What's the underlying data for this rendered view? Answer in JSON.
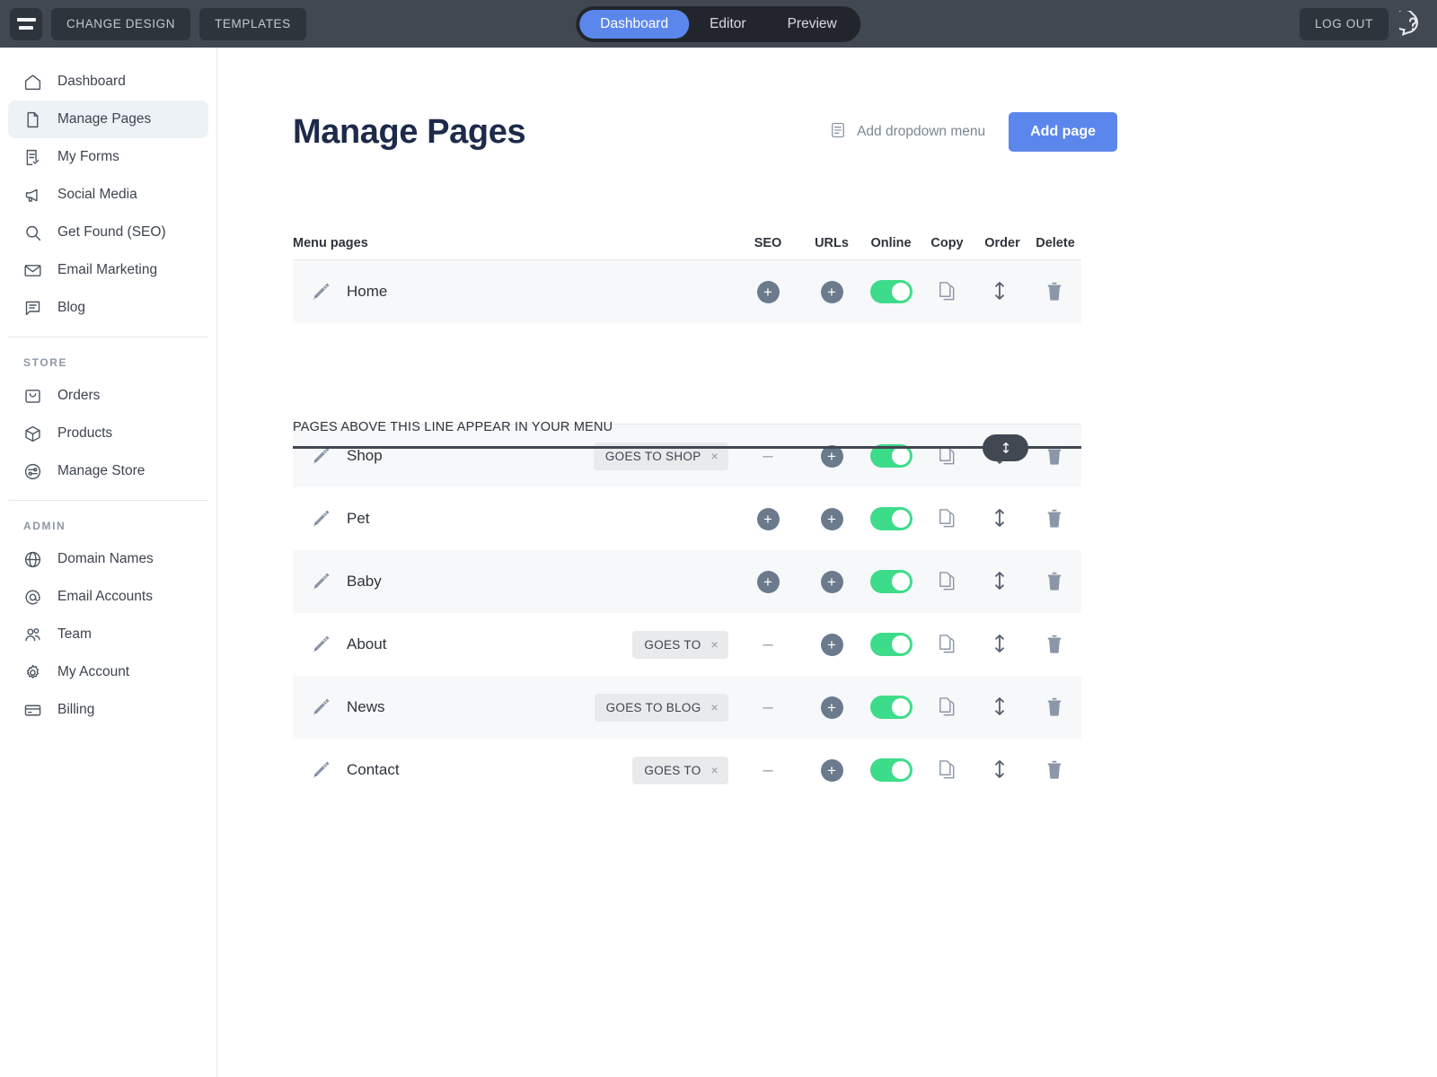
{
  "topbar": {
    "menu_icon": "hamburger-icon",
    "change_design": "CHANGE DESIGN",
    "templates": "TEMPLATES",
    "segments": [
      {
        "label": "Dashboard",
        "active": true
      },
      {
        "label": "Editor",
        "active": false
      },
      {
        "label": "Preview",
        "active": false
      }
    ],
    "log_out": "LOG OUT",
    "help_icon": "help-question-icon",
    "accent": "#5b87ec",
    "bg": "#414852"
  },
  "sidebar": {
    "items": [
      {
        "label": "Dashboard",
        "icon": "home-icon",
        "active": false
      },
      {
        "label": "Manage Pages",
        "icon": "page-icon",
        "active": true
      },
      {
        "label": "My Forms",
        "icon": "form-check-icon",
        "active": false
      },
      {
        "label": "Social Media",
        "icon": "megaphone-icon",
        "active": false
      },
      {
        "label": "Get Found (SEO)",
        "icon": "search-icon",
        "active": false
      },
      {
        "label": "Email Marketing",
        "icon": "envelope-icon",
        "active": false
      },
      {
        "label": "Blog",
        "icon": "chat-bubble-icon",
        "active": false
      }
    ],
    "store_section": "STORE",
    "store_items": [
      {
        "label": "Orders",
        "icon": "inbox-icon"
      },
      {
        "label": "Products",
        "icon": "box-icon"
      },
      {
        "label": "Manage Store",
        "icon": "sliders-circle-icon"
      }
    ],
    "admin_section": "ADMIN",
    "admin_items": [
      {
        "label": "Domain Names",
        "icon": "globe-icon"
      },
      {
        "label": "Email Accounts",
        "icon": "at-sign-icon"
      },
      {
        "label": "Team",
        "icon": "people-icon"
      },
      {
        "label": "My Account",
        "icon": "gear-icon"
      },
      {
        "label": "Billing",
        "icon": "credit-card-icon"
      }
    ]
  },
  "main": {
    "title": "Manage Pages",
    "add_dropdown_label": "Add dropdown menu",
    "add_dropdown_icon": "list-box-icon",
    "add_page_label": "Add page",
    "divider_text": "PAGES ABOVE THIS LINE APPEAR IN YOUR MENU",
    "divider_handle_icon": "drag-vertical-icon",
    "columns": {
      "name": "Menu pages",
      "seo": "SEO",
      "urls": "URLs",
      "online": "Online",
      "copy": "Copy",
      "order": "Order",
      "delete": "Delete"
    },
    "menu_rows": [
      {
        "name": "Home",
        "tag": null,
        "seo": "plus",
        "urls": "plus",
        "online": true,
        "shaded": true
      }
    ],
    "other_rows": [
      {
        "name": "Shop",
        "tag": "GOES TO SHOP",
        "seo": "dash",
        "urls": "plus",
        "online": true,
        "shaded": true
      },
      {
        "name": "Pet",
        "tag": null,
        "seo": "plus",
        "urls": "plus",
        "online": true,
        "shaded": false
      },
      {
        "name": "Baby",
        "tag": null,
        "seo": "plus",
        "urls": "plus",
        "online": true,
        "shaded": true
      },
      {
        "name": "About",
        "tag": "GOES TO",
        "seo": "dash",
        "urls": "plus",
        "online": true,
        "shaded": false
      },
      {
        "name": "News",
        "tag": "GOES TO BLOG",
        "seo": "dash",
        "urls": "plus",
        "online": true,
        "shaded": true
      },
      {
        "name": "Contact",
        "tag": "GOES TO",
        "seo": "dash",
        "urls": "plus",
        "online": true,
        "shaded": false
      }
    ],
    "row_icons": {
      "edit": "pencil-icon",
      "copy": "copy-pages-icon",
      "order": "reorder-arrows-icon",
      "delete": "trash-icon",
      "tag_remove": "×",
      "plus": "+",
      "dash": "–"
    },
    "toggle_on_color": "#3ddc8a"
  }
}
